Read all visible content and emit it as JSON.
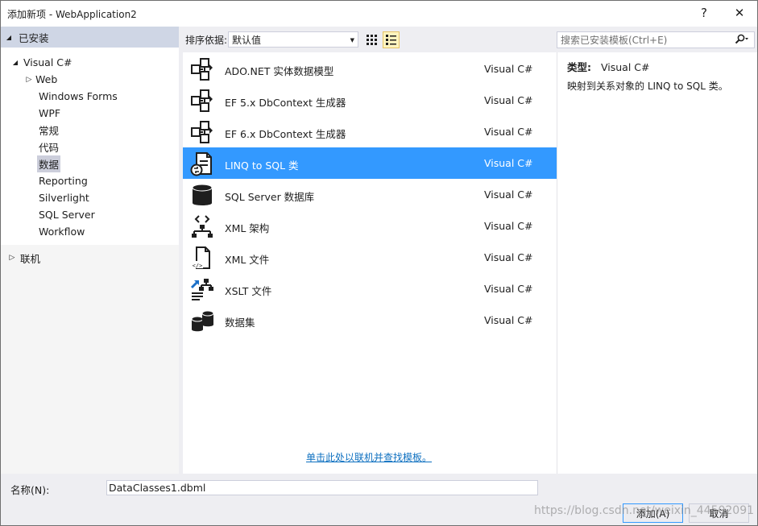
{
  "window": {
    "title": "添加新项 - WebApplication2",
    "help": "?",
    "close": "✕"
  },
  "sidebar": {
    "installed": "已安装",
    "root": "Visual C#",
    "items": [
      {
        "label": "Web",
        "expandable": true
      },
      {
        "label": "Windows Forms",
        "expandable": false
      },
      {
        "label": "WPF",
        "expandable": false
      },
      {
        "label": "常规",
        "expandable": false
      },
      {
        "label": "代码",
        "expandable": false
      },
      {
        "label": "数据",
        "expandable": false,
        "selected": true
      },
      {
        "label": "Reporting",
        "expandable": false
      },
      {
        "label": "Silverlight",
        "expandable": false
      },
      {
        "label": "SQL Server",
        "expandable": false
      },
      {
        "label": "Workflow",
        "expandable": false
      }
    ],
    "online": "联机"
  },
  "toolbar": {
    "sort_label": "排序依据:",
    "sort_value": "默认值",
    "search_placeholder": "搜索已安装模板(Ctrl+E)"
  },
  "templates": [
    {
      "name": "ADO.NET 实体数据模型",
      "lang": "Visual C#",
      "icon": "entity-model-icon"
    },
    {
      "name": "EF 5.x DbContext 生成器",
      "lang": "Visual C#",
      "icon": "entity-model-icon"
    },
    {
      "name": "EF 6.x DbContext 生成器",
      "lang": "Visual C#",
      "icon": "entity-model-icon"
    },
    {
      "name": "LINQ to SQL 类",
      "lang": "Visual C#",
      "icon": "linq-to-sql-icon",
      "selected": true
    },
    {
      "name": "SQL Server 数据库",
      "lang": "Visual C#",
      "icon": "database-icon"
    },
    {
      "name": "XML 架构",
      "lang": "Visual C#",
      "icon": "xml-schema-icon"
    },
    {
      "name": "XML 文件",
      "lang": "Visual C#",
      "icon": "xml-file-icon"
    },
    {
      "name": "XSLT 文件",
      "lang": "Visual C#",
      "icon": "xslt-file-icon"
    },
    {
      "name": "数据集",
      "lang": "Visual C#",
      "icon": "dataset-icon"
    }
  ],
  "online_link": "单击此处以联机并查找模板。",
  "details": {
    "type_label": "类型:",
    "type_value": "Visual C#",
    "description": "映射到关系对象的 LINQ to SQL 类。"
  },
  "bottom": {
    "name_label": "名称(N):",
    "name_value": "DataClasses1.dbml",
    "add_label": "添加(A)",
    "cancel_label": "取消",
    "watermark": "https://blog.csdn.net/weixin_44502091"
  }
}
